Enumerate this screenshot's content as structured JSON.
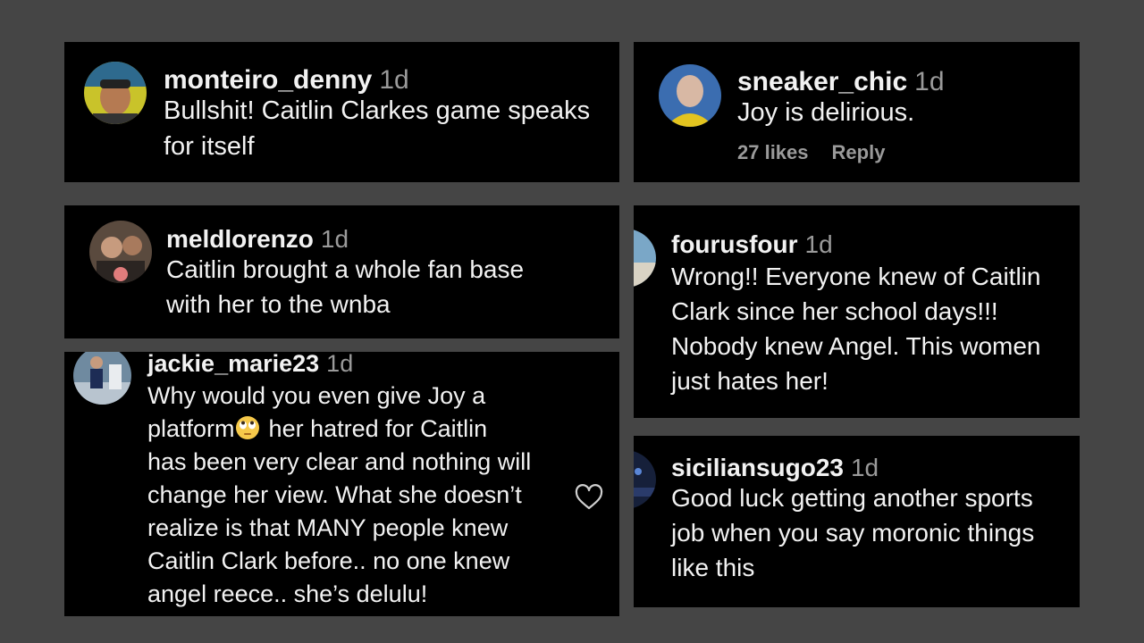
{
  "comments": [
    {
      "username": "monteiro_denny",
      "time": "1d",
      "text": "Bullshit! Caitlin Clarkes game speaks\nfor itself",
      "avatar_icon": "user-avatar"
    },
    {
      "username": "sneaker_chic",
      "time": "1d",
      "text": "Joy is delirious.",
      "likes": "27 likes",
      "reply": "Reply",
      "avatar_icon": "user-avatar"
    },
    {
      "username": "meldlorenzo",
      "time": "1d",
      "text": "Caitlin brought a whole fan base\nwith her to the wnba",
      "avatar_icon": "user-avatar"
    },
    {
      "username": "fourusfour",
      "time": "1d",
      "text": "Wrong!! Everyone knew of Caitlin\nClark since her school days!!!\nNobody knew Angel. This women\njust hates her!",
      "avatar_icon": "user-avatar"
    },
    {
      "username": "jackie_marie23",
      "time": "1d",
      "text_part1": "Why would you even give Joy a\nplatform",
      "emoji": "eye-roll-emoji",
      "text_part2": "her hatred for Caitlin\nhas been very clear and nothing will\nchange her view. What she doesn’t\nrealize is that MANY people knew\nCaitlin Clark before.. no one knew\nangel reece.. she’s delulu!",
      "avatar_icon": "user-avatar",
      "like_icon": "heart-icon"
    },
    {
      "username": "siciliansugo23",
      "time": "1d",
      "text": "Good luck getting another sports\njob when you say moronic things\nlike this",
      "avatar_icon": "user-avatar"
    }
  ],
  "colors": {
    "background": "#454545",
    "card": "#000000",
    "text": "#f2f2f2",
    "muted": "#9a9a9a"
  }
}
